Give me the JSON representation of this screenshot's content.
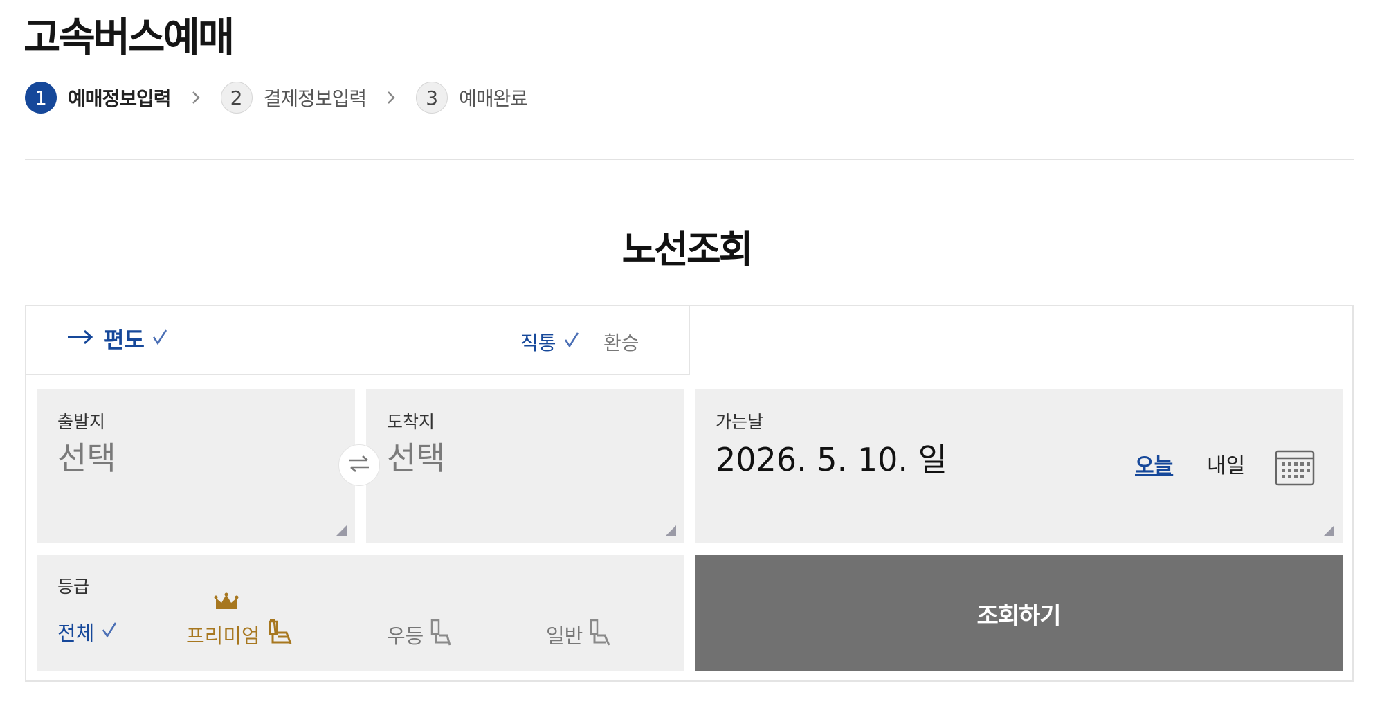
{
  "page": {
    "title": "고속버스예매"
  },
  "steps": [
    {
      "number": "1",
      "label": "예매정보입력",
      "active": true
    },
    {
      "number": "2",
      "label": "결제정보입력",
      "active": false
    },
    {
      "number": "3",
      "label": "예매완료",
      "active": false
    }
  ],
  "section": {
    "title": "노선조회"
  },
  "trip_type": {
    "label": "편도",
    "selected": true
  },
  "route_type": {
    "options": [
      {
        "label": "직통",
        "selected": true
      },
      {
        "label": "환승",
        "selected": false
      }
    ]
  },
  "departure": {
    "label": "출발지",
    "value": "선택"
  },
  "arrival": {
    "label": "도착지",
    "value": "선택"
  },
  "date": {
    "label": "가는날",
    "value": "2026. 5. 10. 일",
    "today_label": "오늘",
    "tomorrow_label": "내일"
  },
  "grade": {
    "label": "등급",
    "options": [
      {
        "label": "전체",
        "selected": true
      },
      {
        "label": "프리미엄",
        "selected": false
      },
      {
        "label": "우등",
        "selected": false
      },
      {
        "label": "일반",
        "selected": false
      }
    ]
  },
  "search_button": {
    "label": "조회하기"
  },
  "colors": {
    "accent": "#16489a",
    "premium": "#a7771f",
    "field_bg": "#efefef",
    "button_bg": "#717171"
  },
  "icons": [
    "arrow-right-icon",
    "check-icon",
    "chevron-right-icon",
    "swap-icon",
    "calendar-icon",
    "crown-icon",
    "seat-icon",
    "resize-corner-icon"
  ]
}
